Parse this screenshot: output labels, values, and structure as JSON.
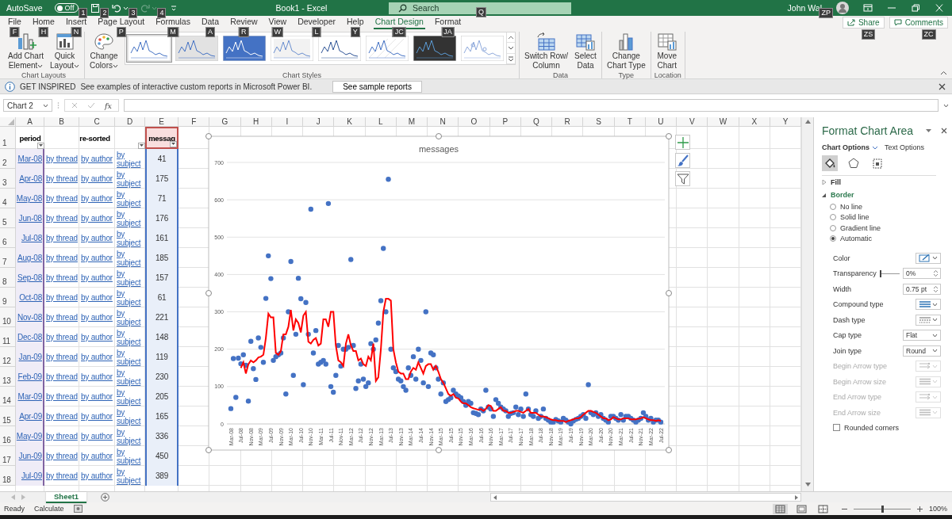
{
  "title_bar": {
    "autosave": {
      "label": "AutoSave",
      "state": "Off",
      "on": false,
      "keytip": "1"
    },
    "quick_access": [
      {
        "kind": "save",
        "keytip": "2",
        "disabled": false
      },
      {
        "kind": "undo",
        "keytip": "3",
        "disabled": false
      },
      {
        "kind": "redo",
        "keytip": "4",
        "disabled": true
      },
      {
        "kind": "customize",
        "disabled": false
      }
    ],
    "title": "Book1  -  Excel",
    "search": {
      "placeholder": "Search",
      "keytip": "Q"
    },
    "user": {
      "name": "John Wal",
      "keytip": "ZP"
    }
  },
  "tabs": [
    {
      "label": "File",
      "keytip": "F",
      "selected": false
    },
    {
      "label": "Home",
      "keytip": "H",
      "selected": false
    },
    {
      "label": "Insert",
      "keytip": "N",
      "selected": false
    },
    {
      "label": "Page Layout",
      "keytip": "P",
      "selected": false
    },
    {
      "label": "Formulas",
      "keytip": "M",
      "selected": false
    },
    {
      "label": "Data",
      "keytip": "A",
      "selected": false
    },
    {
      "label": "Review",
      "keytip": "R",
      "selected": false
    },
    {
      "label": "View",
      "keytip": "W",
      "selected": false
    },
    {
      "label": "Developer",
      "keytip": "L",
      "selected": false
    },
    {
      "label": "Help",
      "keytip": "Y",
      "selected": false
    },
    {
      "label": "Chart Design",
      "keytip": "JC",
      "selected": true
    },
    {
      "label": "Format",
      "keytip": "JA",
      "selected": false
    }
  ],
  "share": {
    "label": "Share",
    "keytip": "ZS"
  },
  "comments": {
    "label": "Comments",
    "keytip": "ZC"
  },
  "ribbon": [
    {
      "label": "Chart Layouts",
      "buttons": [
        {
          "kind": "add-element",
          "label": "Add Chart\nElement",
          "dropdown": true
        },
        {
          "kind": "quick-layout",
          "label": "Quick\nLayout",
          "dropdown": true
        }
      ]
    },
    {
      "label": "Chart Styles",
      "buttons": [
        {
          "kind": "colors",
          "label": "Change\nColors",
          "dropdown": true
        }
      ],
      "styles": [
        {
          "kind": "white",
          "selected": true
        },
        {
          "kind": "gray",
          "selected": false
        },
        {
          "kind": "blue",
          "selected": false
        },
        {
          "kind": "light",
          "selected": false
        },
        {
          "kind": "bold",
          "selected": false
        },
        {
          "kind": "hatched",
          "selected": false
        },
        {
          "kind": "dark",
          "selected": false
        },
        {
          "kind": "outline",
          "selected": false
        }
      ]
    },
    {
      "label": "Data",
      "buttons": [
        {
          "kind": "switch",
          "label": "Switch Row/\nColumn",
          "dropdown": false
        },
        {
          "kind": "select-data",
          "label": "Select\nData",
          "dropdown": false
        }
      ]
    },
    {
      "label": "Type",
      "buttons": [
        {
          "kind": "chart-type",
          "label": "Change\nChart Type",
          "dropdown": false
        }
      ]
    },
    {
      "label": "Location",
      "buttons": [
        {
          "kind": "move",
          "label": "Move\nChart",
          "dropdown": false
        }
      ]
    }
  ],
  "info_bar": {
    "title": "GET INSPIRED",
    "message": "See examples of interactive custom reports in Microsoft Power BI.",
    "button": "See sample reports"
  },
  "formula_bar": {
    "name_box": "Chart 2",
    "fx": "fx"
  },
  "sheet": {
    "columns": [
      {
        "label": "A",
        "kind": "category"
      },
      {
        "label": "B"
      },
      {
        "label": "C"
      },
      {
        "label": "D"
      },
      {
        "label": "E",
        "kind": "values"
      },
      {
        "label": "F"
      },
      {
        "label": "G"
      },
      {
        "label": "H"
      },
      {
        "label": "I"
      },
      {
        "label": "J"
      },
      {
        "label": "K"
      },
      {
        "label": "L"
      },
      {
        "label": "M"
      },
      {
        "label": "N"
      },
      {
        "label": "O"
      },
      {
        "label": "P"
      },
      {
        "label": "Q"
      },
      {
        "label": "R"
      },
      {
        "label": "S"
      },
      {
        "label": "T"
      },
      {
        "label": "U"
      },
      {
        "label": "V"
      },
      {
        "label": "W"
      },
      {
        "label": "X"
      },
      {
        "label": "Y"
      }
    ],
    "header": {
      "number": "1",
      "cells": [
        {
          "text": "period",
          "filter": true
        },
        {
          "text": "re-sorted",
          "kind": "merged",
          "filter": true
        },
        {
          "text": "messag",
          "filter": true
        }
      ]
    },
    "rows": [
      {
        "number": "2",
        "period": "Mar-08",
        "thread": "by thread",
        "author": "by author",
        "subject": "by subject",
        "messages": "41"
      },
      {
        "number": "3",
        "period": "Apr-08",
        "thread": "by thread",
        "author": "by author",
        "subject": "by subject",
        "messages": "175"
      },
      {
        "number": "4",
        "period": "May-08",
        "thread": "by thread",
        "author": "by author",
        "subject": "by subject",
        "messages": "71"
      },
      {
        "number": "5",
        "period": "Jun-08",
        "thread": "by thread",
        "author": "by author",
        "subject": "by subject",
        "messages": "176"
      },
      {
        "number": "6",
        "period": "Jul-08",
        "thread": "by thread",
        "author": "by author",
        "subject": "by subject",
        "messages": "161"
      },
      {
        "number": "7",
        "period": "Aug-08",
        "thread": "by thread",
        "author": "by author",
        "subject": "by subject",
        "messages": "185"
      },
      {
        "number": "8",
        "period": "Sep-08",
        "thread": "by thread",
        "author": "by author",
        "subject": "by subject",
        "messages": "157"
      },
      {
        "number": "9",
        "period": "Oct-08",
        "thread": "by thread",
        "author": "by author",
        "subject": "by subject",
        "messages": "61"
      },
      {
        "number": "10",
        "period": "Nov-08",
        "thread": "by thread",
        "author": "by author",
        "subject": "by subject",
        "messages": "221"
      },
      {
        "number": "11",
        "period": "Dec-08",
        "thread": "by thread",
        "author": "by author",
        "subject": "by subject",
        "messages": "148"
      },
      {
        "number": "12",
        "period": "Jan-09",
        "thread": "by thread",
        "author": "by author",
        "subject": "by subject",
        "messages": "119"
      },
      {
        "number": "13",
        "period": "Feb-09",
        "thread": "by thread",
        "author": "by author",
        "subject": "by subject",
        "messages": "230"
      },
      {
        "number": "14",
        "period": "Mar-09",
        "thread": "by thread",
        "author": "by author",
        "subject": "by subject",
        "messages": "205"
      },
      {
        "number": "15",
        "period": "Apr-09",
        "thread": "by thread",
        "author": "by author",
        "subject": "by subject",
        "messages": "165"
      },
      {
        "number": "16",
        "period": "May-09",
        "thread": "by thread",
        "author": "by author",
        "subject": "by subject",
        "messages": "336"
      },
      {
        "number": "17",
        "period": "Jun-09",
        "thread": "by thread",
        "author": "by author",
        "subject": "by subject",
        "messages": "450"
      },
      {
        "number": "18",
        "period": "Jul-09",
        "thread": "by thread",
        "author": "by author",
        "subject": "by subject",
        "messages": "389"
      }
    ]
  },
  "chart": {
    "buttons": [
      {
        "kind": "elements"
      },
      {
        "kind": "styles"
      },
      {
        "kind": "filters"
      }
    ],
    "chart_data": {
      "type": "scatter",
      "title": "messages",
      "ylim": [
        0,
        700
      ],
      "categories": [
        "Mar-08",
        null,
        null,
        null,
        "Jul-08",
        null,
        null,
        null,
        "Nov-08",
        null,
        null,
        null,
        "Mar-09",
        null,
        null,
        null,
        "Jul-09",
        null,
        null,
        null,
        "Nov-09",
        null,
        null,
        null,
        "Mar-10",
        null,
        null,
        null,
        "Jul-10",
        null,
        null,
        null,
        "Nov-10",
        null,
        null,
        null,
        "Mar-11",
        null,
        null,
        null,
        "Jul-11",
        null,
        null,
        null,
        "Nov-11",
        null,
        null,
        null,
        "Mar-12",
        null,
        null,
        null,
        "Jul-12",
        null,
        null,
        null,
        "Nov-12",
        null,
        null,
        null,
        "Mar-13",
        null,
        null,
        null,
        "Jul-13",
        null,
        null,
        null,
        "Nov-13",
        null,
        null,
        null,
        "Mar-14",
        null,
        null,
        null,
        "Jul-14",
        null,
        null,
        null,
        "Nov-14",
        null,
        null,
        null,
        "Mar-15",
        null,
        null,
        null,
        "Jul-15",
        null,
        null,
        null,
        "Nov-15",
        null,
        null,
        null,
        "Mar-16",
        null,
        null,
        null,
        "Jul-16",
        null,
        null,
        null,
        "Nov-16",
        null,
        null,
        null,
        "Mar-17",
        null,
        null,
        null,
        "Jul-17",
        null,
        null,
        null,
        "Nov-17",
        null,
        null,
        null,
        "Mar-18",
        null,
        null,
        null,
        "Jul-18",
        null,
        null,
        null,
        "Nov-18",
        null,
        null,
        null,
        "Mar-19",
        null,
        null,
        null,
        "Jul-19",
        null,
        null,
        null,
        "Nov-19",
        null,
        null,
        null,
        "Mar-20",
        null,
        null,
        null,
        "Jul-20",
        null,
        null,
        null,
        "Nov-20",
        null,
        null,
        null,
        "Mar-21",
        null,
        null,
        null,
        "Jul-21",
        null,
        null,
        null,
        "Nov-21",
        null,
        null,
        null,
        "Mar-22",
        null,
        null,
        null,
        "Jul-22"
      ],
      "yticks": [
        0,
        100,
        200,
        300,
        400,
        500,
        600,
        700
      ],
      "grid": true,
      "series": [
        {
          "type": "scatter",
          "color": "#4472c4",
          "values": [
            41,
            175,
            71,
            176,
            161,
            185,
            157,
            61,
            221,
            148,
            119,
            230,
            205,
            165,
            336,
            450,
            389,
            170,
            180,
            185,
            190,
            230,
            80,
            300,
            435,
            130,
            240,
            390,
            335,
            105,
            325,
            240,
            575,
            190,
            250,
            160,
            165,
            170,
            160,
            590,
            100,
            85,
            130,
            210,
            155,
            200,
            200,
            205,
            440,
            210,
            95,
            115,
            160,
            120,
            100,
            110,
            215,
            200,
            225,
            270,
            330,
            470,
            300,
            655,
            200,
            150,
            140,
            120,
            115,
            100,
            90,
            150,
            130,
            180,
            120,
            200,
            170,
            110,
            300,
            100,
            190,
            185,
            150,
            120,
            80,
            110,
            60,
            65,
            70,
            90,
            80,
            75,
            70,
            60,
            50,
            60,
            55,
            30,
            28,
            25,
            40,
            35,
            90,
            45,
            40,
            20,
            65,
            55,
            45,
            40,
            35,
            20,
            28,
            30,
            45,
            25,
            40,
            20,
            80,
            40,
            25,
            20,
            35,
            15,
            20,
            40,
            15,
            10,
            5,
            5,
            12,
            8,
            5,
            15,
            10,
            5,
            0,
            8,
            12,
            15,
            20,
            25,
            15,
            105,
            30,
            25,
            30,
            20,
            25,
            15,
            10,
            5,
            20,
            20,
            15,
            10,
            25,
            10,
            20,
            20,
            15,
            10,
            5,
            10,
            15,
            30,
            20,
            10,
            15,
            5,
            10,
            10,
            5
          ]
        },
        {
          "type": "line",
          "color": "#ff0000",
          "values": [
            null,
            null,
            null,
            null,
            150,
            165,
            135,
            160,
            170,
            165,
            170,
            178,
            180,
            185,
            230,
            295,
            285,
            285,
            190,
            185,
            195,
            240,
            240,
            260,
            305,
            250,
            280,
            270,
            245,
            290,
            300,
            220,
            215,
            225,
            230,
            210,
            215,
            280,
            280,
            260,
            300,
            300,
            210,
            170,
            165,
            155,
            215,
            240,
            210,
            195,
            195,
            170,
            175,
            160,
            155,
            180,
            170,
            215,
            115,
            125,
            200,
            300,
            335,
            335,
            330,
            200,
            165,
            140,
            135,
            135,
            120,
            120,
            140,
            150,
            145,
            165,
            150,
            135,
            155,
            160,
            160,
            145,
            155,
            140,
            120,
            110,
            95,
            80,
            75,
            80,
            70,
            68,
            60,
            55,
            55,
            50,
            45,
            42,
            40,
            38,
            40,
            35,
            40,
            50,
            48,
            35,
            35,
            40,
            45,
            35,
            35,
            30,
            30,
            32,
            35,
            35,
            32,
            30,
            35,
            40,
            30,
            30,
            30,
            25,
            20,
            20,
            18,
            15,
            12,
            10,
            10,
            8,
            8,
            8,
            5,
            8,
            10,
            12,
            15,
            15,
            18,
            25,
            30,
            35,
            35,
            32,
            30,
            25,
            20,
            15,
            15,
            10,
            12,
            18,
            15,
            12,
            12,
            15,
            15,
            15,
            12,
            12,
            12,
            14,
            15,
            18,
            15,
            12,
            10,
            10,
            8,
            10,
            8
          ]
        }
      ]
    }
  },
  "pane": {
    "title": "Format Chart Area",
    "tabs": [
      {
        "label": "Chart Options",
        "selected": true,
        "dropdown": true
      },
      {
        "label": "Text Options",
        "selected": false,
        "dropdown": false
      }
    ],
    "icons": [
      {
        "kind": "fill",
        "selected": true
      },
      {
        "kind": "effects",
        "selected": false
      },
      {
        "kind": "size",
        "selected": false
      }
    ],
    "sections": [
      {
        "label": "Fill",
        "expanded": false
      },
      {
        "label": "Border",
        "expanded": true,
        "options": [
          {
            "label": "No line",
            "selected": false
          },
          {
            "label": "Solid line",
            "selected": false
          },
          {
            "label": "Gradient line",
            "selected": false
          },
          {
            "label": "Automatic",
            "selected": true
          }
        ],
        "properties": [
          {
            "kind": "color",
            "label": "Color",
            "disabled": false
          },
          {
            "kind": "slider",
            "label": "Transparency",
            "level": 0,
            "value": "0%",
            "disabled": false
          },
          {
            "kind": "spin",
            "label": "Width",
            "value": "0.75 pt",
            "disabled": false
          },
          {
            "kind": "compound",
            "label": "Compound type",
            "disabled": false
          },
          {
            "kind": "dash",
            "label": "Dash type",
            "disabled": false
          },
          {
            "kind": "select",
            "label": "Cap type",
            "value": "Flat",
            "disabled": false
          },
          {
            "kind": "select",
            "label": "Join type",
            "value": "Round",
            "disabled": false
          },
          {
            "kind": "arrow",
            "label": "Begin Arrow type",
            "disabled": true
          },
          {
            "kind": "size",
            "label": "Begin Arrow size",
            "disabled": true
          },
          {
            "kind": "arrow",
            "label": "End Arrow type",
            "disabled": true
          },
          {
            "kind": "size",
            "label": "End Arrow size",
            "disabled": true
          }
        ],
        "rounded_corners": {
          "label": "Rounded corners",
          "checked": false
        }
      }
    ]
  },
  "sheet_tabs": [
    {
      "label": "Sheet1",
      "selected": true
    }
  ],
  "status_bar": {
    "mode": "Ready",
    "calculate": "Calculate",
    "views": [
      {
        "kind": "normal",
        "selected": true
      },
      {
        "kind": "page-layout",
        "selected": false
      },
      {
        "kind": "page-break",
        "selected": false
      }
    ],
    "zoom": {
      "level": 0.5,
      "label": "100%"
    }
  }
}
